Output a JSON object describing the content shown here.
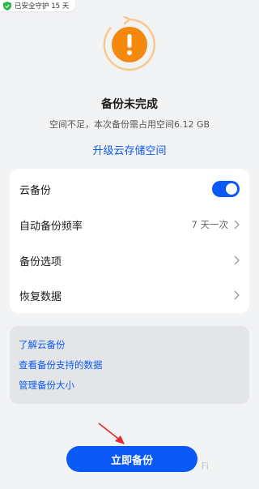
{
  "status": {
    "safe_badge": "已安全守护 15 天"
  },
  "hero": {
    "title": "备份未完成",
    "subtitle": "空间不足，本次备份需占用空间6.12 GB",
    "upgrade_link": "升级云存储空间",
    "icon": "exclamation-circle-icon"
  },
  "settings": {
    "cloud_backup": {
      "label": "云备份",
      "enabled": true
    },
    "auto_frequency": {
      "label": "自动备份频率",
      "value": "7 天一次"
    },
    "backup_options": {
      "label": "备份选项"
    },
    "restore_data": {
      "label": "恢复数据"
    }
  },
  "links": [
    "了解云备份",
    "查看备份支持的数据",
    "管理备份大小"
  ],
  "actions": {
    "backup_now": "立即备份"
  },
  "watermark": "Fi",
  "colors": {
    "accent": "#0a59f7",
    "warning": "#f5890e"
  }
}
